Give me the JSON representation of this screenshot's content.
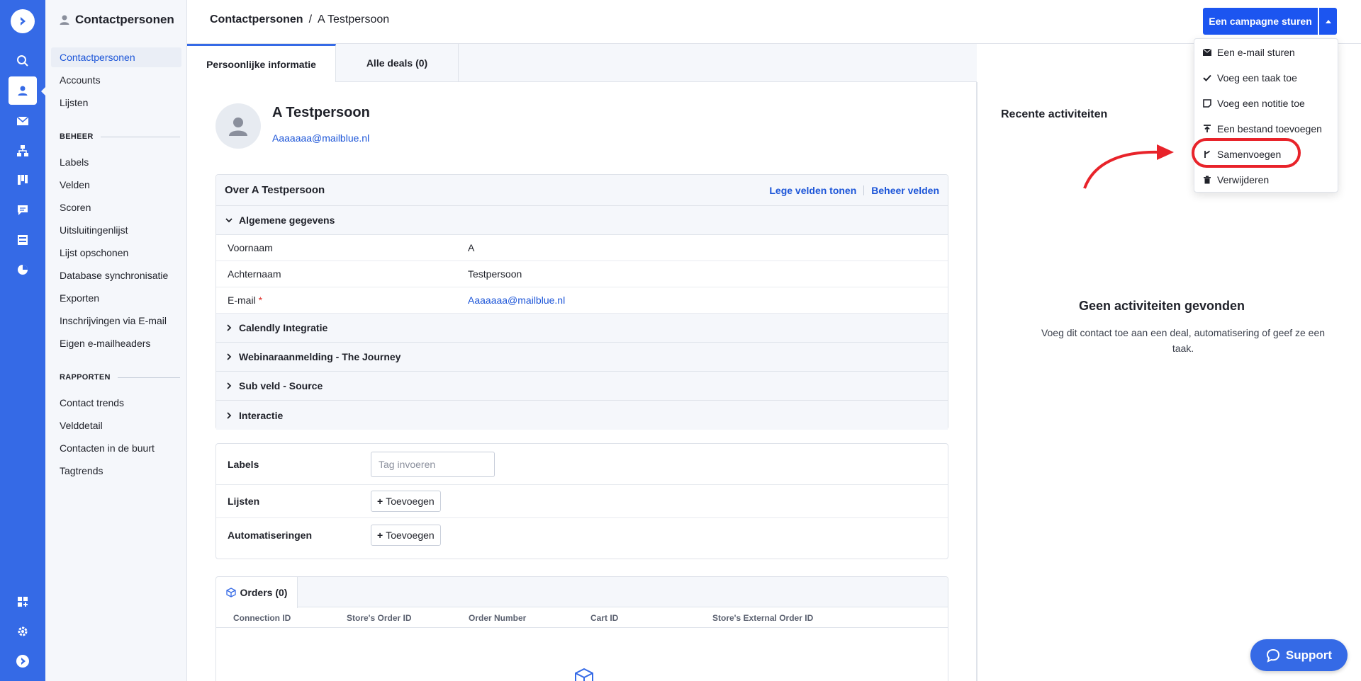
{
  "rail": {
    "icons": [
      "logo-icon",
      "search-icon",
      "contacts-icon",
      "mail-icon",
      "sitemap-icon",
      "kanban-icon",
      "chat-icon",
      "forms-icon",
      "pie-chart-icon",
      "apps-icon",
      "settings-icon",
      "help-icon"
    ]
  },
  "subnav": {
    "title": "Contactpersonen",
    "items_top": [
      "Contactpersonen",
      "Accounts",
      "Lijsten"
    ],
    "section_beheer": "BEHEER",
    "items_beheer": [
      "Labels",
      "Velden",
      "Scoren",
      "Uitsluitingenlijst",
      "Lijst opschonen",
      "Database synchronisatie",
      "Exporten",
      "Inschrijvingen via E-mail",
      "Eigen e-mailheaders"
    ],
    "section_rapporten": "RAPPORTEN",
    "items_rapporten": [
      "Contact trends",
      "Velddetail",
      "Contacten in de buurt",
      "Tagtrends"
    ]
  },
  "header": {
    "breadcrumb_root": "Contactpersonen",
    "breadcrumb_sep": "/",
    "breadcrumb_current": "A Testpersoon",
    "campaign_button": "Een campagne sturen"
  },
  "tabs": [
    "Persoonlijke informatie",
    "Alle deals (0)"
  ],
  "contact": {
    "name": "A Testpersoon",
    "email": "Aaaaaaa@mailblue.nl"
  },
  "about": {
    "title": "Over A Testpersoon",
    "show_empty": "Lege velden tonen",
    "manage_fields": "Beheer velden",
    "general_section": "Algemene gegevens",
    "fields": [
      {
        "label": "Voornaam",
        "value": "A"
      },
      {
        "label": "Achternaam",
        "value": "Testpersoon"
      },
      {
        "label": "E-mail",
        "required_mark": "*",
        "value": "Aaaaaaa@mailblue.nl"
      }
    ],
    "collapsed_sections": [
      "Calendly Integratie",
      "Webinaraanmelding - The Journey",
      "Sub veld - Source",
      "Interactie"
    ]
  },
  "labels_card": {
    "labels_label": "Labels",
    "tag_placeholder": "Tag invoeren",
    "lists_label": "Lijsten",
    "automations_label": "Automatiseringen",
    "add_button": "Toevoegen",
    "add_symbol": "+"
  },
  "orders": {
    "tab": "Orders (0)",
    "columns": [
      "Connection ID",
      "Store's Order ID",
      "Order Number",
      "Cart ID",
      "Store's External Order ID"
    ]
  },
  "activity": {
    "title": "Recente activiteiten",
    "empty_title": "Geen activiteiten gevonden",
    "empty_text": "Voeg dit contact toe aan een deal, automatisering of geef ze een taak."
  },
  "dropdown": {
    "items": [
      "Een e-mail sturen",
      "Voeg een taak toe",
      "Voeg een notitie toe",
      "Een bestand toevoegen",
      "Samenvoegen",
      "Verwijderen"
    ],
    "highlighted": "Samenvoegen"
  },
  "support": {
    "label": "Support"
  },
  "colors": {
    "rail": "#356ae6",
    "primary_button": "#1c55f0",
    "link": "#1c55d8",
    "annotation": "#e8232a"
  }
}
